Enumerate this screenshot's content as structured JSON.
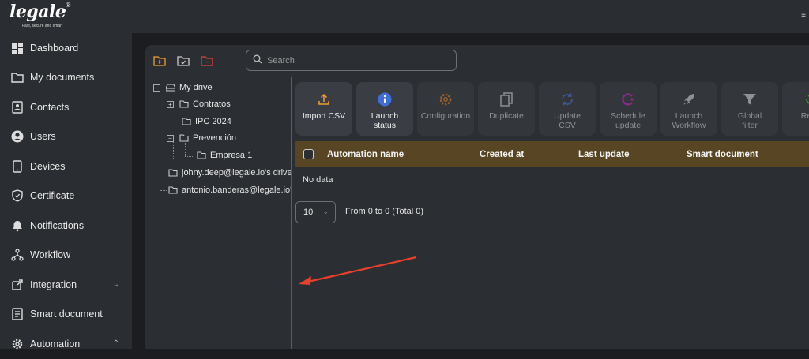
{
  "brand": {
    "name": "legale",
    "tagline": "Fast, secure and smart"
  },
  "sidebar": {
    "items": [
      {
        "label": "Dashboard",
        "icon": "dashboard-icon"
      },
      {
        "label": "My documents",
        "icon": "folder-icon"
      },
      {
        "label": "Contacts",
        "icon": "contacts-icon"
      },
      {
        "label": "Users",
        "icon": "user-icon"
      },
      {
        "label": "Devices",
        "icon": "tablet-icon"
      },
      {
        "label": "Certificate",
        "icon": "shield-check-icon"
      },
      {
        "label": "Notifications",
        "icon": "bell-icon"
      },
      {
        "label": "Workflow",
        "icon": "workflow-icon"
      },
      {
        "label": "Integration",
        "icon": "external-link-icon",
        "chevron": "down"
      },
      {
        "label": "Smart document",
        "icon": "smart-doc-icon"
      },
      {
        "label": "Automation",
        "icon": "gear-icon",
        "chevron": "up"
      }
    ]
  },
  "search": {
    "placeholder": "Search"
  },
  "tree": {
    "root": "My drive",
    "items": [
      "Contratos",
      "IPC 2024",
      "Prevención",
      "Empresa 1"
    ],
    "drives": [
      "johny.deep@legale.io's drive",
      "antonio.banderas@legale.io's d"
    ]
  },
  "actions": [
    {
      "label": "Import CSV",
      "icon": "upload-icon",
      "enabled": true
    },
    {
      "label": "Launch status",
      "icon": "info-icon",
      "enabled": true
    },
    {
      "label": "Configuration",
      "icon": "gear-icon",
      "enabled": false
    },
    {
      "label": "Duplicate",
      "icon": "copy-icon",
      "enabled": false
    },
    {
      "label": "Update CSV",
      "icon": "sync-icon",
      "enabled": false
    },
    {
      "label": "Schedule update",
      "icon": "schedule-icon",
      "enabled": false
    },
    {
      "label": "Launch Workflow",
      "icon": "rocket-icon",
      "enabled": false
    },
    {
      "label": "Global filter",
      "icon": "filter-icon",
      "enabled": false
    },
    {
      "label": "Rese",
      "icon": "reset-icon",
      "enabled": false
    }
  ],
  "table": {
    "columns": [
      "Automation name",
      "Created at",
      "Last update",
      "Smart document"
    ],
    "empty_text": "No data"
  },
  "pagination": {
    "page_size": "10",
    "info": "From 0 to 0 (Total 0)"
  },
  "colors": {
    "accent": "#f0a030",
    "table_header": "#574524",
    "annotation_arrow": "#e8402a"
  }
}
